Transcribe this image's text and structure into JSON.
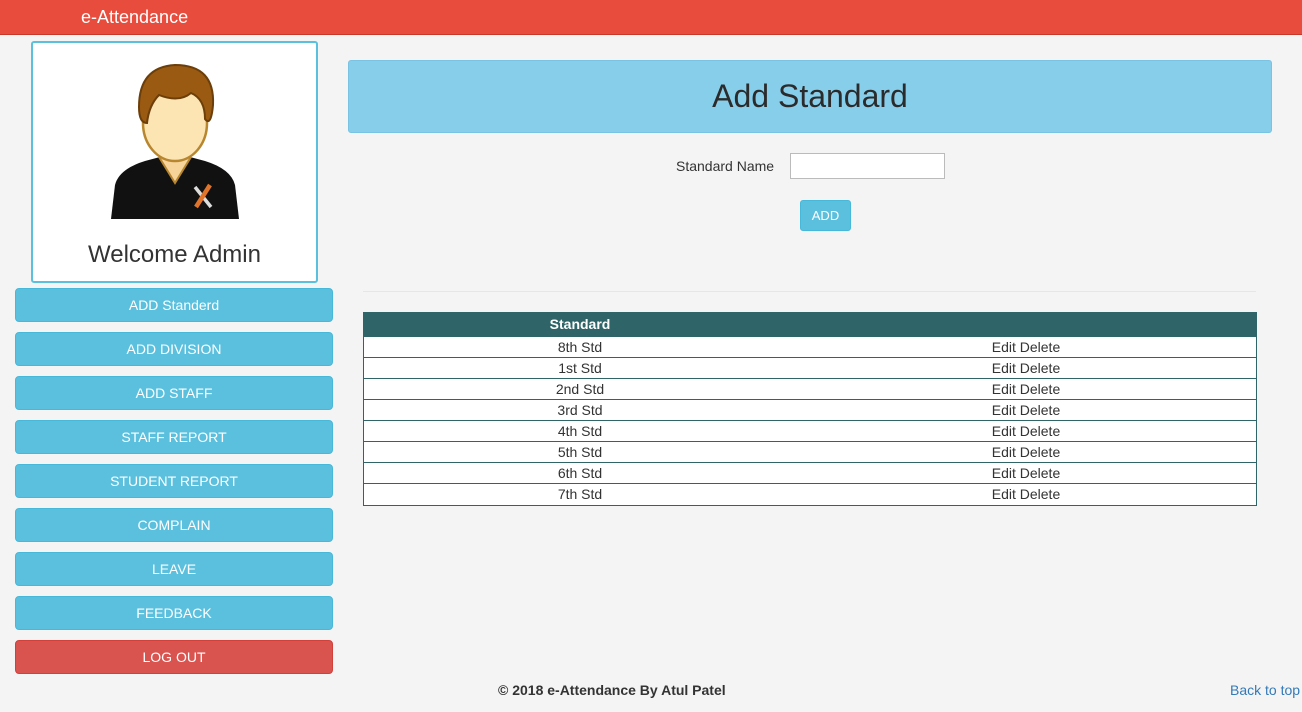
{
  "app": {
    "brand": "e-Attendance"
  },
  "profile": {
    "welcome": "Welcome Admin",
    "avatar_icon": "admin-user-icon"
  },
  "sidebar": {
    "items": [
      {
        "label": "ADD Standerd"
      },
      {
        "label": "ADD DIVISION"
      },
      {
        "label": "ADD STAFF"
      },
      {
        "label": "STAFF REPORT"
      },
      {
        "label": "STUDENT REPORT"
      },
      {
        "label": "COMPLAIN"
      },
      {
        "label": "LEAVE"
      },
      {
        "label": "FEEDBACK"
      }
    ],
    "logout": "LOG OUT"
  },
  "main": {
    "title": "Add Standard",
    "form": {
      "label": "Standard Name",
      "value": "",
      "button": "ADD"
    },
    "table": {
      "headers": [
        "Standard",
        ""
      ],
      "rows": [
        {
          "standard": "8th Std",
          "edit": "Edit",
          "delete": "Delete"
        },
        {
          "standard": "1st Std",
          "edit": "Edit",
          "delete": "Delete"
        },
        {
          "standard": "2nd Std",
          "edit": "Edit",
          "delete": "Delete"
        },
        {
          "standard": "3rd Std",
          "edit": "Edit",
          "delete": "Delete"
        },
        {
          "standard": "4th Std",
          "edit": "Edit",
          "delete": "Delete"
        },
        {
          "standard": "5th Std",
          "edit": "Edit",
          "delete": "Delete"
        },
        {
          "standard": "6th Std",
          "edit": "Edit",
          "delete": "Delete"
        },
        {
          "standard": "7th Std",
          "edit": "Edit",
          "delete": "Delete"
        }
      ]
    }
  },
  "footer": {
    "copyright": "© 2018 e-Attendance By Atul Patel",
    "back_to_top": "Back to top"
  },
  "colors": {
    "topbar": "#e84c3d",
    "button": "#5bc0de",
    "danger": "#d9534f",
    "header": "#87ceeb",
    "table_head": "#2f6568",
    "link": "#337ab7"
  }
}
